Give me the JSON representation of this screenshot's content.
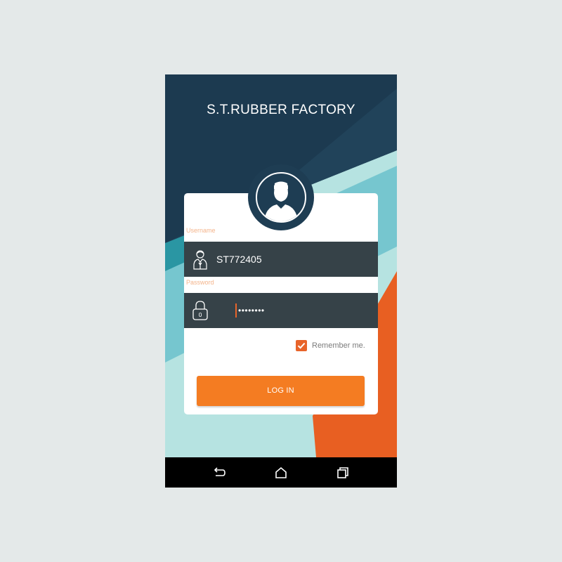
{
  "app": {
    "title": "S.T.RUBBER FACTORY"
  },
  "form": {
    "username_label": "Username",
    "username_value": "ST772405",
    "password_label": "Password",
    "password_value": "••••••••",
    "remember_label": "Remember me.",
    "remember_checked": true,
    "login_label": "LOG IN"
  },
  "icons": {
    "avatar": "user-silhouette-icon",
    "username": "person-icon",
    "password": "lock-icon",
    "remember": "checkmark-icon",
    "nav_back": "back-icon",
    "nav_home": "home-icon",
    "nav_recents": "recents-icon"
  },
  "colors": {
    "header_navy": "#1e3d53",
    "accent_orange": "#f47c22",
    "field_dark": "#364248",
    "teal_light": "#b6e3e1",
    "label_peach": "#f4b48b"
  }
}
